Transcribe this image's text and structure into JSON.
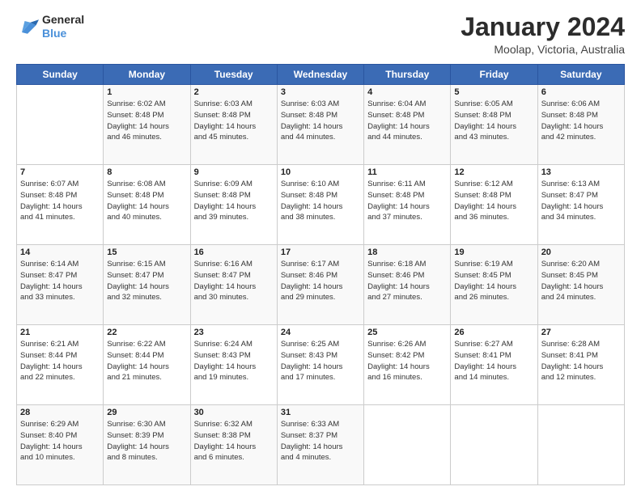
{
  "logo": {
    "line1": "General",
    "line2": "Blue"
  },
  "title": "January 2024",
  "subtitle": "Moolap, Victoria, Australia",
  "days_of_week": [
    "Sunday",
    "Monday",
    "Tuesday",
    "Wednesday",
    "Thursday",
    "Friday",
    "Saturday"
  ],
  "weeks": [
    [
      {
        "day": "",
        "info": ""
      },
      {
        "day": "1",
        "info": "Sunrise: 6:02 AM\nSunset: 8:48 PM\nDaylight: 14 hours\nand 46 minutes."
      },
      {
        "day": "2",
        "info": "Sunrise: 6:03 AM\nSunset: 8:48 PM\nDaylight: 14 hours\nand 45 minutes."
      },
      {
        "day": "3",
        "info": "Sunrise: 6:03 AM\nSunset: 8:48 PM\nDaylight: 14 hours\nand 44 minutes."
      },
      {
        "day": "4",
        "info": "Sunrise: 6:04 AM\nSunset: 8:48 PM\nDaylight: 14 hours\nand 44 minutes."
      },
      {
        "day": "5",
        "info": "Sunrise: 6:05 AM\nSunset: 8:48 PM\nDaylight: 14 hours\nand 43 minutes."
      },
      {
        "day": "6",
        "info": "Sunrise: 6:06 AM\nSunset: 8:48 PM\nDaylight: 14 hours\nand 42 minutes."
      }
    ],
    [
      {
        "day": "7",
        "info": "Sunrise: 6:07 AM\nSunset: 8:48 PM\nDaylight: 14 hours\nand 41 minutes."
      },
      {
        "day": "8",
        "info": "Sunrise: 6:08 AM\nSunset: 8:48 PM\nDaylight: 14 hours\nand 40 minutes."
      },
      {
        "day": "9",
        "info": "Sunrise: 6:09 AM\nSunset: 8:48 PM\nDaylight: 14 hours\nand 39 minutes."
      },
      {
        "day": "10",
        "info": "Sunrise: 6:10 AM\nSunset: 8:48 PM\nDaylight: 14 hours\nand 38 minutes."
      },
      {
        "day": "11",
        "info": "Sunrise: 6:11 AM\nSunset: 8:48 PM\nDaylight: 14 hours\nand 37 minutes."
      },
      {
        "day": "12",
        "info": "Sunrise: 6:12 AM\nSunset: 8:48 PM\nDaylight: 14 hours\nand 36 minutes."
      },
      {
        "day": "13",
        "info": "Sunrise: 6:13 AM\nSunset: 8:47 PM\nDaylight: 14 hours\nand 34 minutes."
      }
    ],
    [
      {
        "day": "14",
        "info": "Sunrise: 6:14 AM\nSunset: 8:47 PM\nDaylight: 14 hours\nand 33 minutes."
      },
      {
        "day": "15",
        "info": "Sunrise: 6:15 AM\nSunset: 8:47 PM\nDaylight: 14 hours\nand 32 minutes."
      },
      {
        "day": "16",
        "info": "Sunrise: 6:16 AM\nSunset: 8:47 PM\nDaylight: 14 hours\nand 30 minutes."
      },
      {
        "day": "17",
        "info": "Sunrise: 6:17 AM\nSunset: 8:46 PM\nDaylight: 14 hours\nand 29 minutes."
      },
      {
        "day": "18",
        "info": "Sunrise: 6:18 AM\nSunset: 8:46 PM\nDaylight: 14 hours\nand 27 minutes."
      },
      {
        "day": "19",
        "info": "Sunrise: 6:19 AM\nSunset: 8:45 PM\nDaylight: 14 hours\nand 26 minutes."
      },
      {
        "day": "20",
        "info": "Sunrise: 6:20 AM\nSunset: 8:45 PM\nDaylight: 14 hours\nand 24 minutes."
      }
    ],
    [
      {
        "day": "21",
        "info": "Sunrise: 6:21 AM\nSunset: 8:44 PM\nDaylight: 14 hours\nand 22 minutes."
      },
      {
        "day": "22",
        "info": "Sunrise: 6:22 AM\nSunset: 8:44 PM\nDaylight: 14 hours\nand 21 minutes."
      },
      {
        "day": "23",
        "info": "Sunrise: 6:24 AM\nSunset: 8:43 PM\nDaylight: 14 hours\nand 19 minutes."
      },
      {
        "day": "24",
        "info": "Sunrise: 6:25 AM\nSunset: 8:43 PM\nDaylight: 14 hours\nand 17 minutes."
      },
      {
        "day": "25",
        "info": "Sunrise: 6:26 AM\nSunset: 8:42 PM\nDaylight: 14 hours\nand 16 minutes."
      },
      {
        "day": "26",
        "info": "Sunrise: 6:27 AM\nSunset: 8:41 PM\nDaylight: 14 hours\nand 14 minutes."
      },
      {
        "day": "27",
        "info": "Sunrise: 6:28 AM\nSunset: 8:41 PM\nDaylight: 14 hours\nand 12 minutes."
      }
    ],
    [
      {
        "day": "28",
        "info": "Sunrise: 6:29 AM\nSunset: 8:40 PM\nDaylight: 14 hours\nand 10 minutes."
      },
      {
        "day": "29",
        "info": "Sunrise: 6:30 AM\nSunset: 8:39 PM\nDaylight: 14 hours\nand 8 minutes."
      },
      {
        "day": "30",
        "info": "Sunrise: 6:32 AM\nSunset: 8:38 PM\nDaylight: 14 hours\nand 6 minutes."
      },
      {
        "day": "31",
        "info": "Sunrise: 6:33 AM\nSunset: 8:37 PM\nDaylight: 14 hours\nand 4 minutes."
      },
      {
        "day": "",
        "info": ""
      },
      {
        "day": "",
        "info": ""
      },
      {
        "day": "",
        "info": ""
      }
    ]
  ]
}
